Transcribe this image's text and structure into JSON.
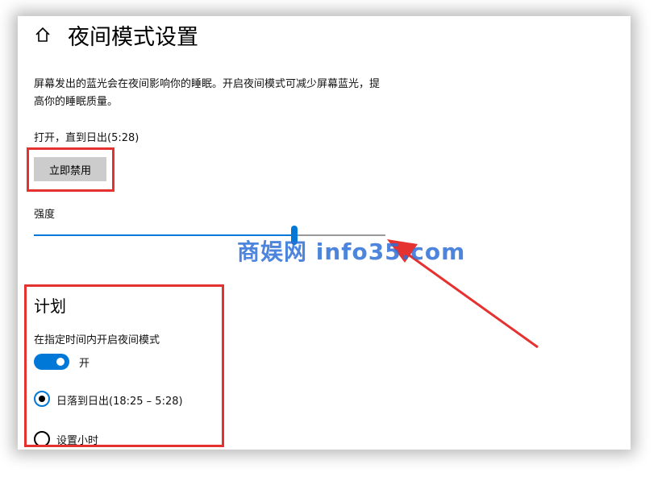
{
  "window": {
    "title": "夜间模式设置",
    "description": "屏幕发出的蓝光会在夜间影响你的睡眠。开启夜间模式可减少屏幕蓝光，提高你的睡眠质量。",
    "status": "打开，直到日出(5:28)",
    "disable_button": "立即禁用",
    "strength_label": "强度",
    "strength_value": 0.74,
    "schedule": {
      "title": "计划",
      "toggle_label": "在指定时间内开启夜间模式",
      "toggle_state": "开",
      "toggle_on": true,
      "options": [
        {
          "label": "日落到日出(18:25 – 5:28)",
          "selected": true
        },
        {
          "label": "设置小时",
          "selected": false
        }
      ]
    }
  },
  "annotations": {
    "watermark": "商娱网 info35.com",
    "highlight_color": "#e5312f"
  },
  "colors": {
    "accent": "#0078d7",
    "button_bg": "#cccccc"
  }
}
